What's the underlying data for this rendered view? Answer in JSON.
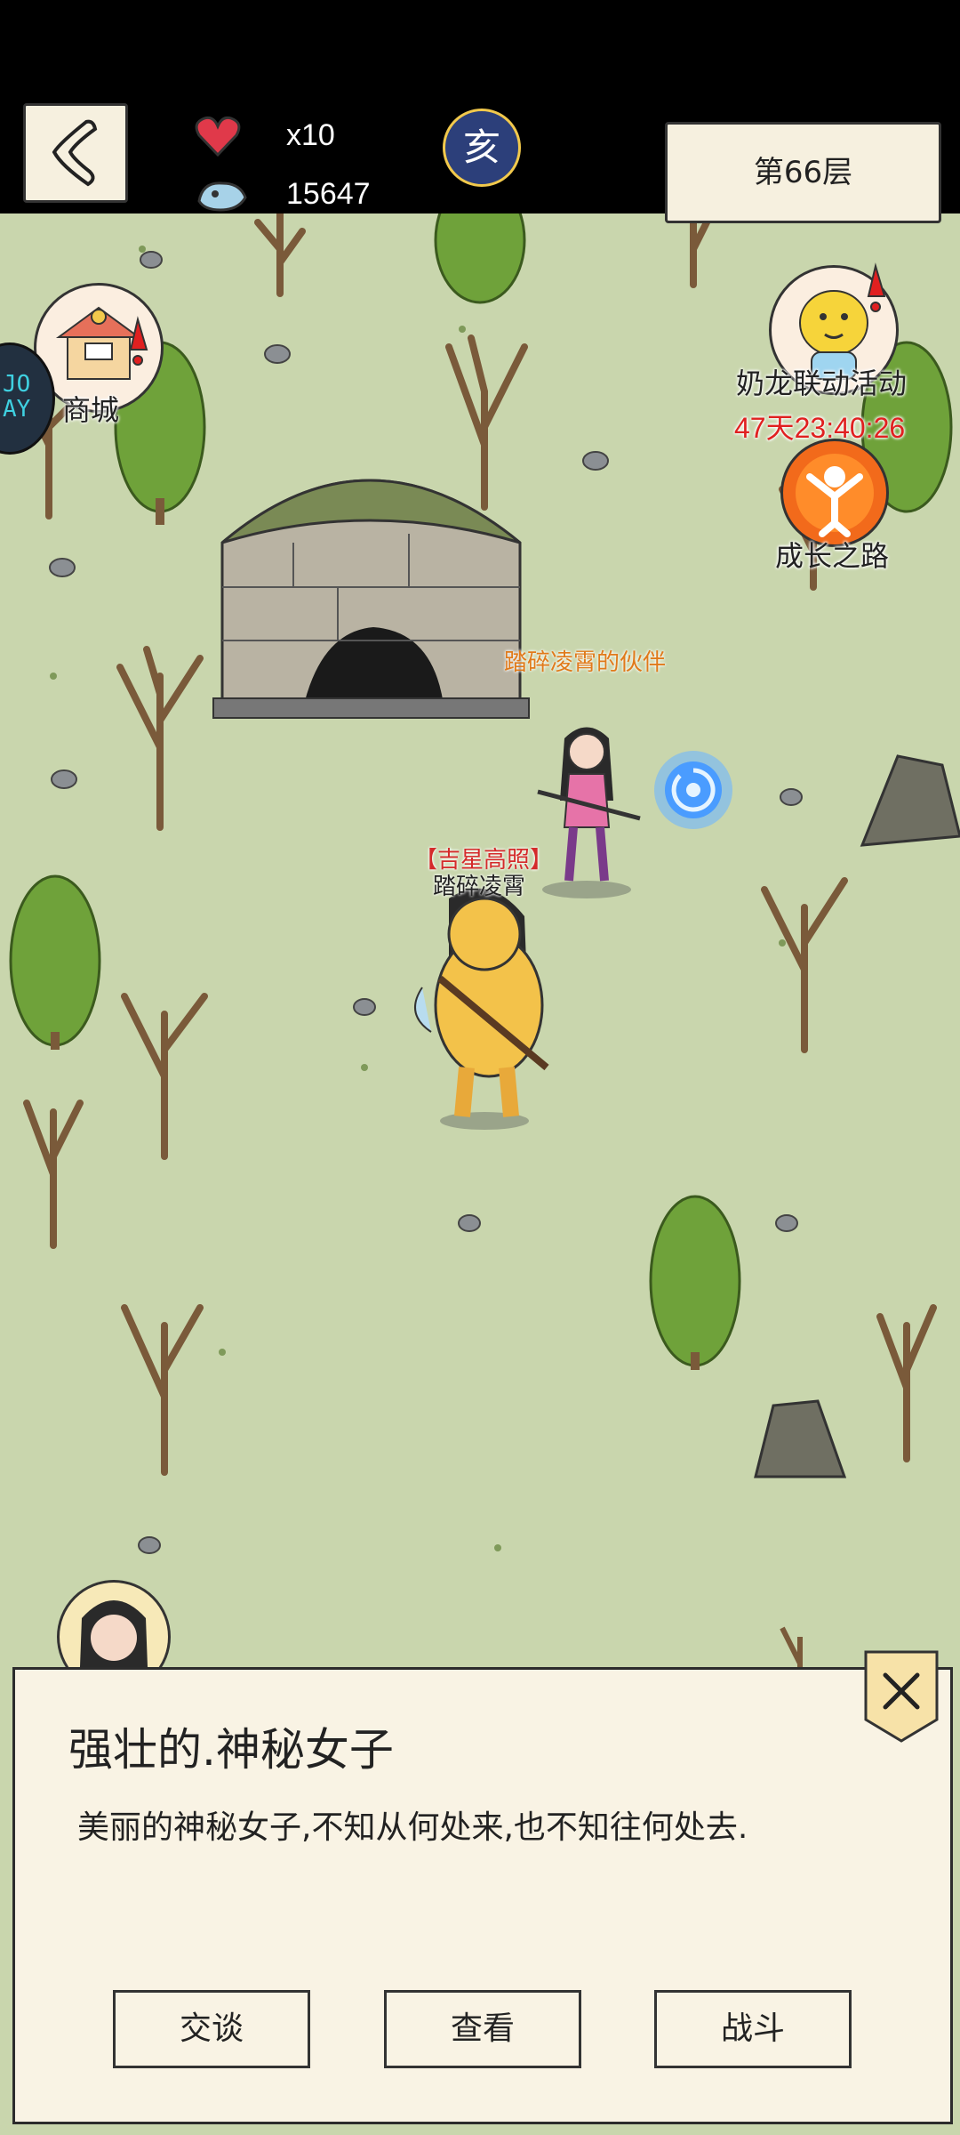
{
  "header": {
    "lives": "x10",
    "currency": "15647",
    "zodiac_glyph": "亥",
    "floor": "第66层"
  },
  "map": {
    "shop_label": "商城",
    "event_label": "奶龙联动活动",
    "event_timer": "47天23:40:26",
    "growth_label": "成长之路",
    "companion_label": "踏碎凌霄的伙伴",
    "player_title": "【吉星高照】",
    "player_name": "踏碎凌霄",
    "side_badge_text": "JO AY"
  },
  "dialog": {
    "title": "强壮的.神秘女子",
    "description": "美丽的神秘女子,不知从何处来,也不知往何处去.",
    "buttons": [
      "交谈",
      "查看",
      "战斗"
    ]
  },
  "colors": {
    "grass": "#c9d6ad",
    "panel": "#f6f0df",
    "timer": "#e02020",
    "companion_label": "#e07a1a",
    "title_red": "#d42a2a"
  },
  "icons": [
    "back-arrow-icon",
    "heart-icon",
    "currency-icon",
    "zodiac-icon",
    "shop-icon",
    "alert-icon",
    "event-icon",
    "growth-icon",
    "close-icon",
    "portal-icon"
  ]
}
